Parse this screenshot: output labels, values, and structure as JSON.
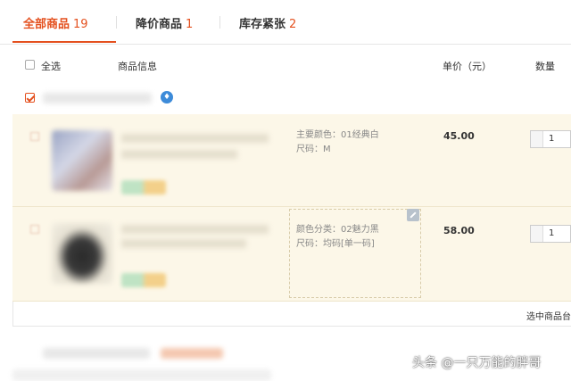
{
  "tabs": [
    {
      "label": "全部商品",
      "count": "19"
    },
    {
      "label": "降价商品",
      "count": "1"
    },
    {
      "label": "库存紧张",
      "count": "2"
    }
  ],
  "table_header": {
    "select_all": "全选",
    "product_info": "商品信息",
    "unit_price": "单价（元）",
    "quantity": "数量"
  },
  "items": [
    {
      "spec_line1": "主要颜色：01经典白",
      "spec_line2": "尺码：M",
      "price": "45.00",
      "quantity": "1"
    },
    {
      "spec_line1": "颜色分类：02魅力黑",
      "spec_line2": "尺码：均码[单一码]",
      "price": "58.00",
      "quantity": "1"
    }
  ],
  "footer": {
    "selected_text": "选中商品台"
  },
  "watermark": "头条 @一只万能的胖哥",
  "colors": {
    "accent": "#e4501e",
    "item_bg": "#fcf7e8",
    "badge": "#3d8bd9"
  }
}
